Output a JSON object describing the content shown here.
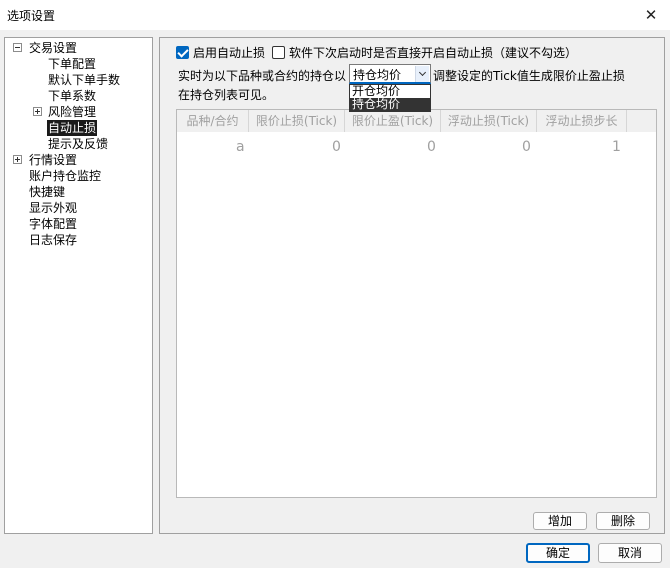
{
  "window": {
    "title": "选项设置",
    "close_glyph": "✕"
  },
  "tree": {
    "items": [
      {
        "label": "交易设置",
        "expander": "minus",
        "selected": false
      },
      {
        "label": "下单配置",
        "expander": "",
        "selected": false
      },
      {
        "label": "默认下单手数",
        "expander": "",
        "selected": false
      },
      {
        "label": "下单系数",
        "expander": "",
        "selected": false
      },
      {
        "label": "风险管理",
        "expander": "plus",
        "selected": false
      },
      {
        "label": "自动止损",
        "expander": "",
        "selected": true
      },
      {
        "label": "提示及反馈",
        "expander": "",
        "selected": false
      },
      {
        "label": "行情设置",
        "expander": "plus",
        "selected": false
      },
      {
        "label": "账户持仓监控",
        "expander": "",
        "selected": false
      },
      {
        "label": "快捷键",
        "expander": "",
        "selected": false
      },
      {
        "label": "显示外观",
        "expander": "",
        "selected": false
      },
      {
        "label": "字体配置",
        "expander": "",
        "selected": false
      },
      {
        "label": "日志保存",
        "expander": "",
        "selected": false
      }
    ]
  },
  "settings": {
    "enable_label": "启用自动止损",
    "enable_checked": true,
    "startup_label": "软件下次启动时是否直接开启自动止损（建议不勾选）",
    "startup_checked": false,
    "desc_prefix": "实时为以下品种或合约的持仓以",
    "desc_suffix": "调整设定的Tick值生成限价止盈止损",
    "desc_line2": "在持仓列表可见。",
    "price_basis": {
      "selected": "持仓均价",
      "options": [
        "开仓均价",
        "持仓均价"
      ],
      "highlighted": 1
    }
  },
  "table": {
    "columns": [
      "品种/合约",
      "限价止损(Tick)",
      "限价止盈(Tick)",
      "浮动止损(Tick)",
      "浮动止损步长"
    ],
    "rows": [
      [
        "a",
        "0",
        "0",
        "0",
        "1"
      ]
    ]
  },
  "buttons": {
    "add": "增加",
    "delete": "删除",
    "ok": "确定",
    "cancel": "取消"
  },
  "colors": {
    "accent": "#0067c0",
    "selection": "#1a1a1a"
  }
}
